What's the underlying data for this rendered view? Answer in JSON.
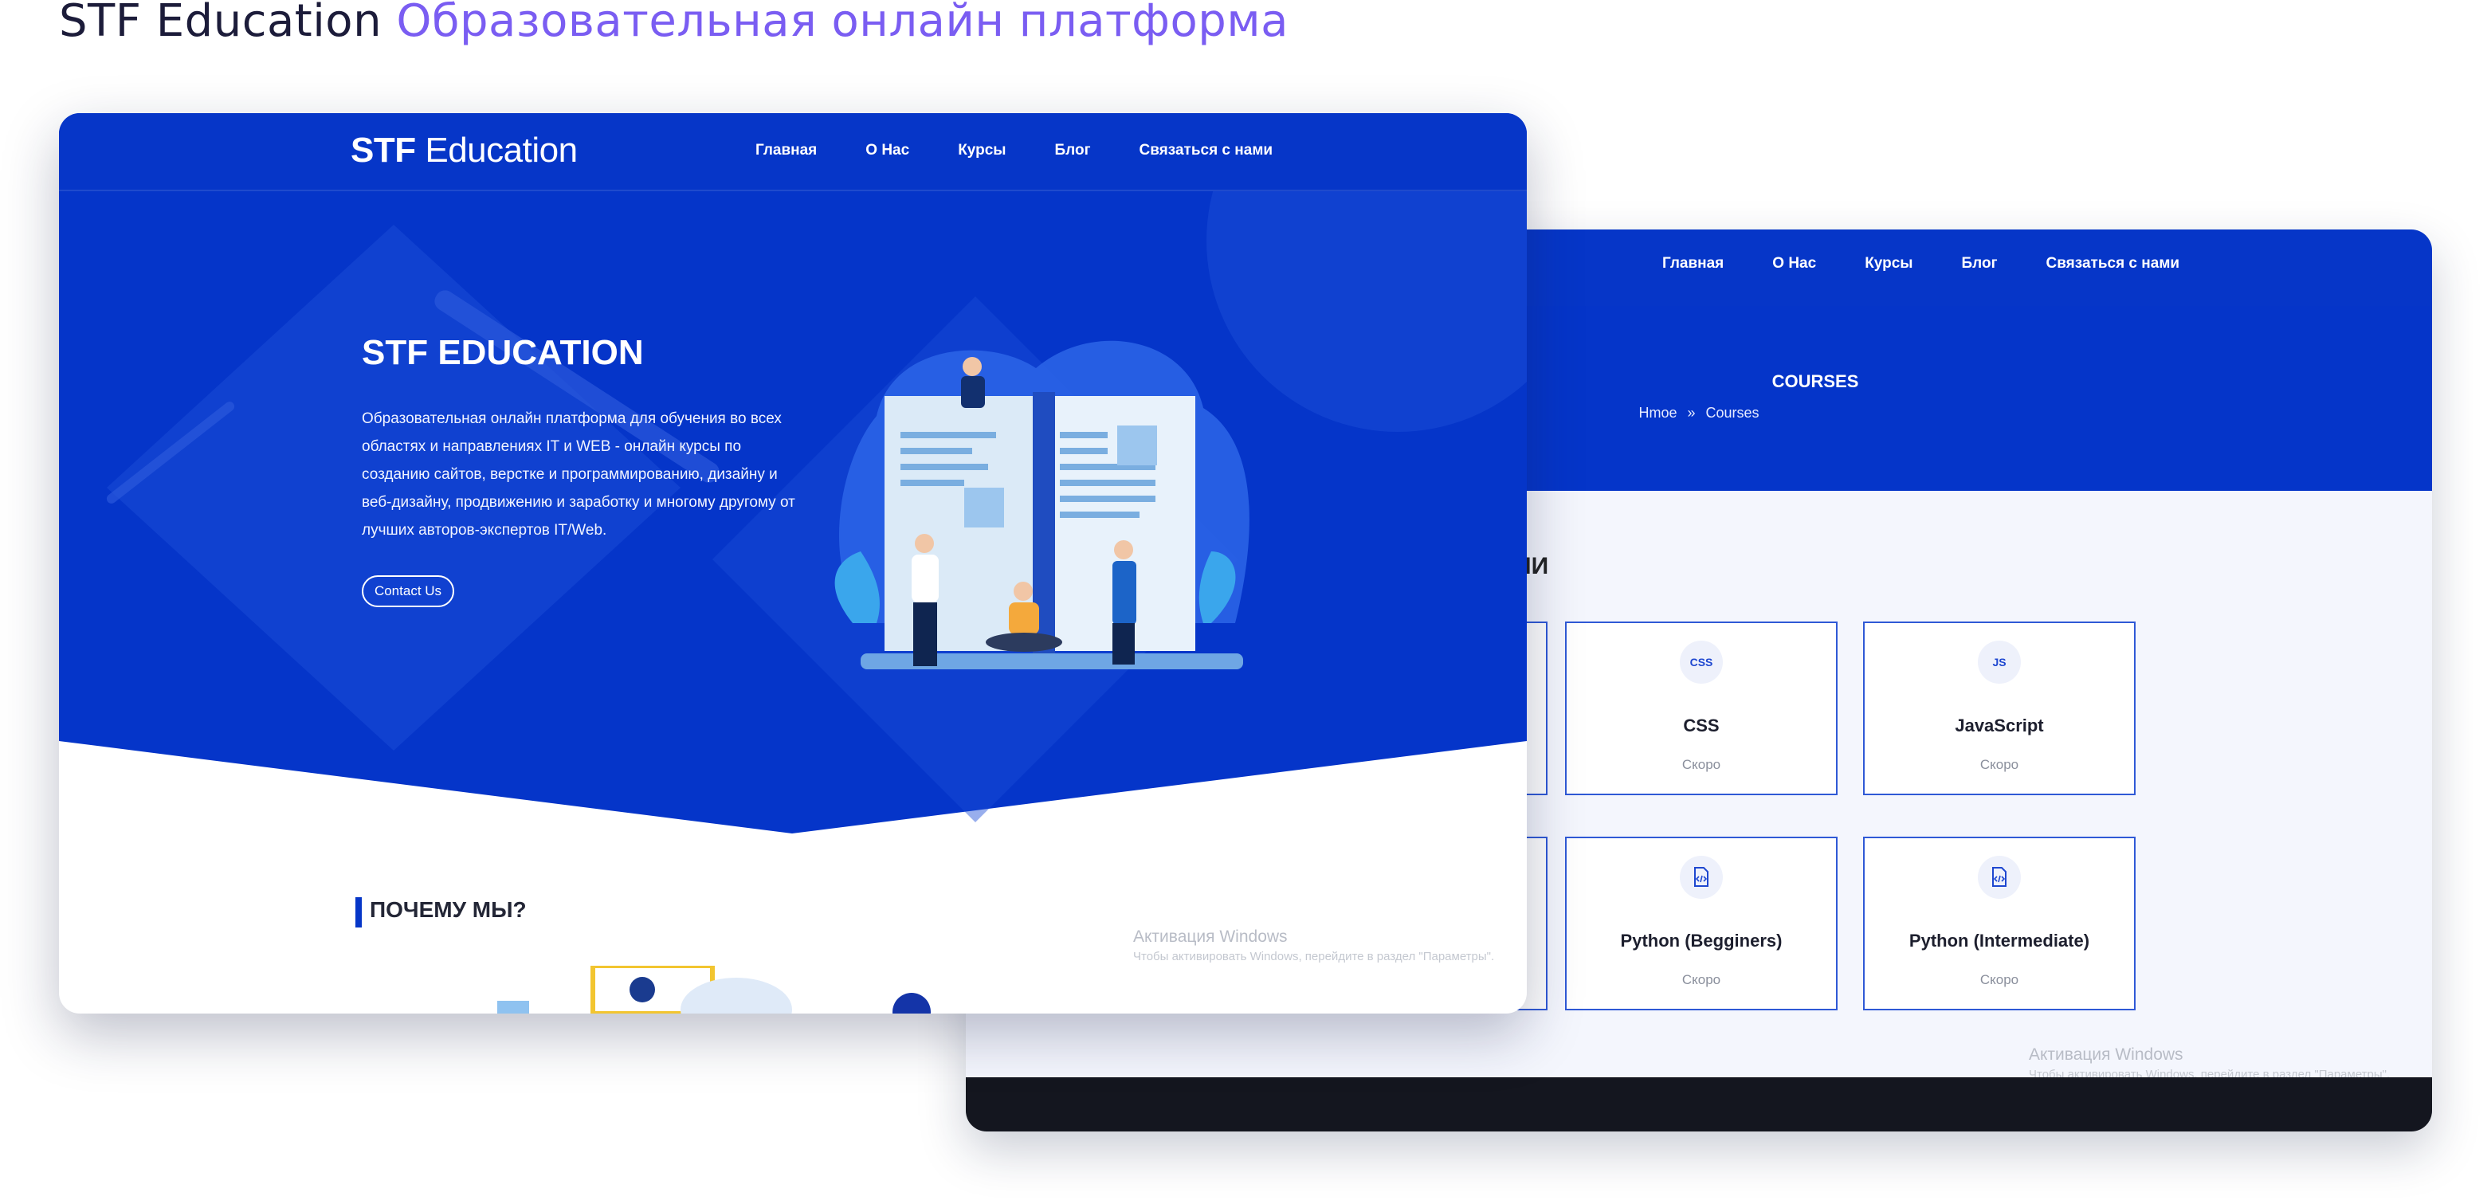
{
  "heading": {
    "brand": "STF Education",
    "subtitle": "Образовательная онлайн платформа"
  },
  "colors": {
    "brand_blue": "#0636c8",
    "accent_purple": "#7a5df2",
    "footer_dark": "#14161f"
  },
  "courses_window": {
    "nav": [
      "Главная",
      "О Нас",
      "Курсы",
      "Блог",
      "Связаться с нами"
    ],
    "page_title": "COURSES",
    "breadcrumb": {
      "home": "Hmoe",
      "separator": "»",
      "current": "Courses"
    },
    "section_heading_visible": "ИИ",
    "cards": [
      {
        "icon": "css-icon",
        "icon_text": "CSS",
        "name": "CSS",
        "status": "Скоро"
      },
      {
        "icon": "js-icon",
        "icon_text": "JS",
        "name": "JavaScript",
        "status": "Скоро"
      },
      {
        "icon": "code-file-icon",
        "icon_text": "",
        "name": "Python (Begginers)",
        "status": "Скоро"
      },
      {
        "icon": "code-file-icon",
        "icon_text": "",
        "name": "Python (Intermediate)",
        "status": "Скоро"
      }
    ],
    "watermark": {
      "title": "Активация Windows",
      "subtitle": "Чтобы активировать Windows, перейдите в раздел \"Параметры\"."
    }
  },
  "home_window": {
    "logo": {
      "bold": "STF",
      "regular": "Education"
    },
    "nav": [
      "Главная",
      "О Нас",
      "Курсы",
      "Блог",
      "Связаться с нами"
    ],
    "hero_title": "STF EDUCATION",
    "hero_text": "Образовательная онлайн платформа для обучения во всех областях и направлениях IT и WEB - онлайн курсы по созданию сайтов, верстке и программированию, дизайну и веб-дизайну, продвижению и заработку и многому другому от лучших авторов-экспертов IT/Web.",
    "contact_button": "Contact Us",
    "why_heading": "ПОЧЕМУ МЫ?",
    "watermark": {
      "title": "Активация Windows",
      "subtitle": "Чтобы активировать Windows, перейдите в раздел \"Параметры\"."
    }
  }
}
